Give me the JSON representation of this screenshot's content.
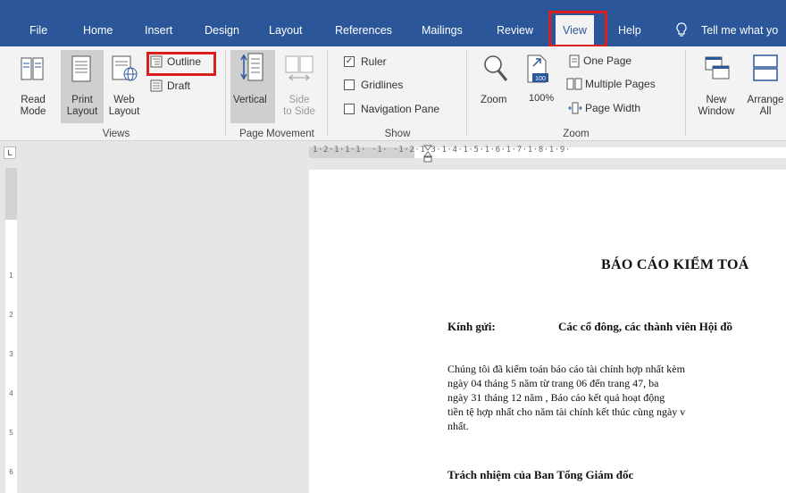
{
  "tabs": {
    "file": "File",
    "home": "Home",
    "insert": "Insert",
    "design": "Design",
    "layout": "Layout",
    "references": "References",
    "mailings": "Mailings",
    "review": "Review",
    "view": "View",
    "help": "Help",
    "tell_me": "Tell me what yo"
  },
  "ribbon": {
    "views": {
      "group": "Views",
      "read_mode": [
        "Read",
        "Mode"
      ],
      "print_layout": [
        "Print",
        "Layout"
      ],
      "web_layout": [
        "Web",
        "Layout"
      ],
      "outline": "Outline",
      "draft": "Draft"
    },
    "page_movement": {
      "group": "Page Movement",
      "vertical": "Vertical",
      "side_to_side": [
        "Side",
        "to Side"
      ]
    },
    "show": {
      "group": "Show",
      "ruler": "Ruler",
      "gridlines": "Gridlines",
      "navigation_pane": "Navigation Pane"
    },
    "zoom": {
      "group": "Zoom",
      "zoom": "Zoom",
      "hundred": "100%",
      "badge": "100",
      "one_page": "One Page",
      "multiple_pages": "Multiple Pages",
      "page_width": "Page Width"
    },
    "window": {
      "new_window": [
        "New",
        "Window"
      ],
      "arrange_all": [
        "Arrange",
        "All"
      ]
    }
  },
  "ruler": {
    "tab_stop": "L",
    "h_marks": "1·2·1·1·1·   ·1·  ·1·2·1·3·1·4·1·5·1·6·1·7·1·8·1·9·",
    "v_marks": [
      "1",
      "2",
      "3",
      "4",
      "5",
      "6"
    ]
  },
  "document": {
    "title": "BÁO CÁO KIỂM TOÁ",
    "kinh_gui": "Kính gửi:",
    "addressees": "Các cổ đông, các thành viên Hội đồ",
    "paragraph": [
      "Chúng tôi đã kiểm toán báo cáo tài chính hợp nhất kèm",
      "ngày 04 tháng 5 năm            từ trang 06 đến trang 47, ba",
      "ngày 31 tháng 12 năm        , Báo cáo kết quả hoạt động",
      "tiền tệ hợp nhất cho năm tài chính kết thúc cùng ngày v",
      "nhất."
    ],
    "heading": "Trách nhiệm của Ban Tổng Giám đốc"
  },
  "colors": {
    "tab_bar": "#2b579a",
    "ribbon": "#f3f3f3",
    "highlight": "#d9201f",
    "accent_icon": "#2b579a"
  },
  "icons": [
    "read-mode-icon",
    "print-layout-icon",
    "web-layout-icon",
    "outline-icon",
    "draft-icon",
    "vertical-icon",
    "side-to-side-icon",
    "zoom-magnifier-icon",
    "zoom-100-icon",
    "one-page-icon",
    "multiple-pages-icon",
    "page-width-icon",
    "new-window-icon",
    "arrange-all-icon",
    "lightbulb-icon"
  ]
}
